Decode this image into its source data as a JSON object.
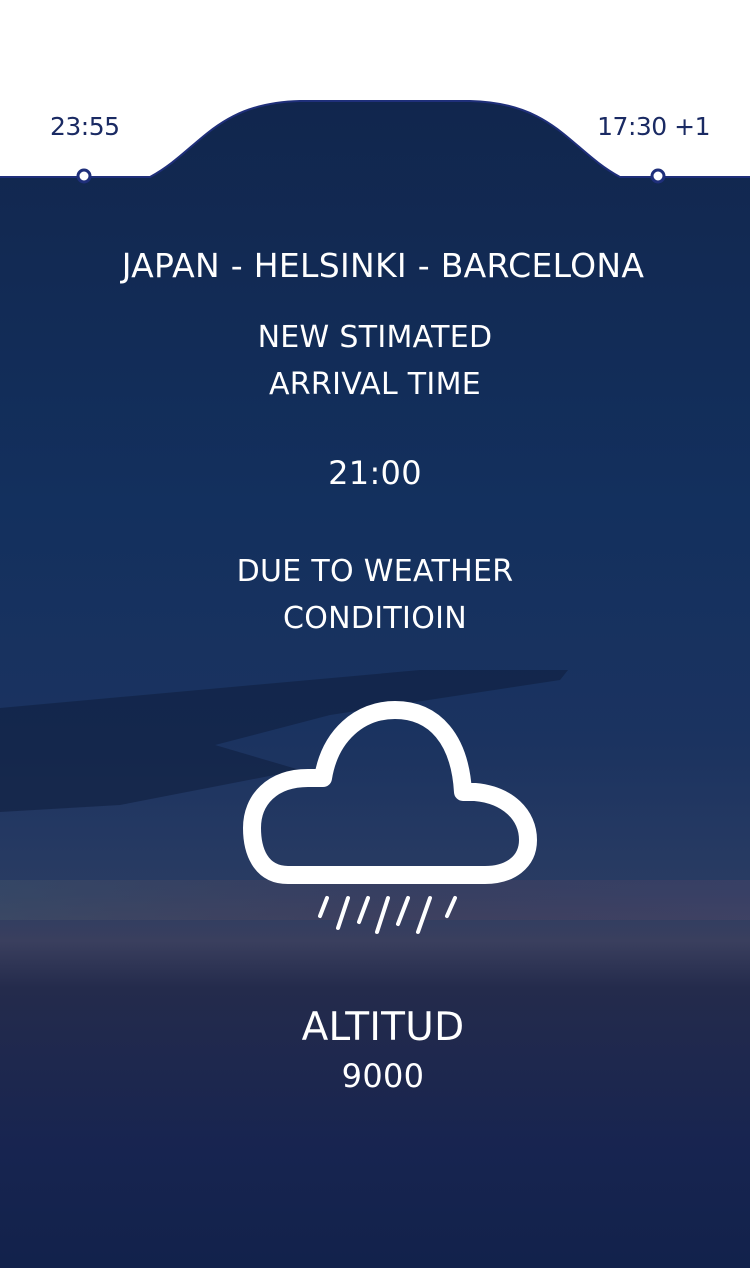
{
  "flight": {
    "departure_time": "23:55",
    "arrival_time": "17:30 +1",
    "route": "JAPAN - HELSINKI - BARCELONA",
    "notice_line1": "NEW STIMATED",
    "notice_line2": "ARRIVAL TIME",
    "new_eta": "21:00",
    "reason_line1": "DUE TO WEATHER",
    "reason_line2": "CONDITIOIN",
    "altitude_label": "ALTITUD",
    "altitude_value": "9000"
  },
  "weather_icon": "cloud-rain-icon",
  "colors": {
    "panel_top": "#0f2247",
    "panel_bottom": "#132650",
    "accent_text": "#1a2a63",
    "foreground": "#ffffff"
  }
}
